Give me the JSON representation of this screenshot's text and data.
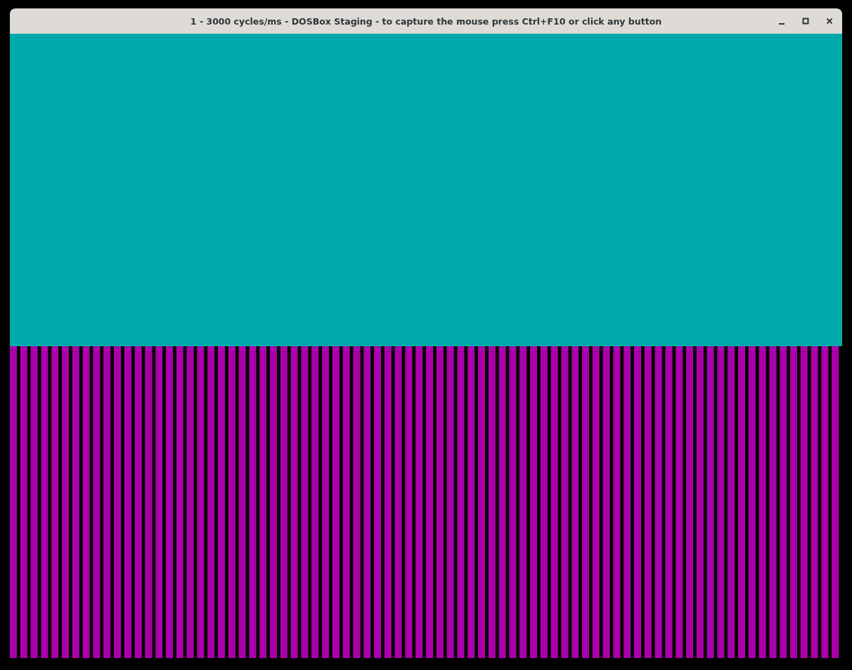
{
  "window": {
    "title": "1 - 3000 cycles/ms - DOSBox Staging - to capture the mouse press Ctrl+F10 or click any button"
  }
}
